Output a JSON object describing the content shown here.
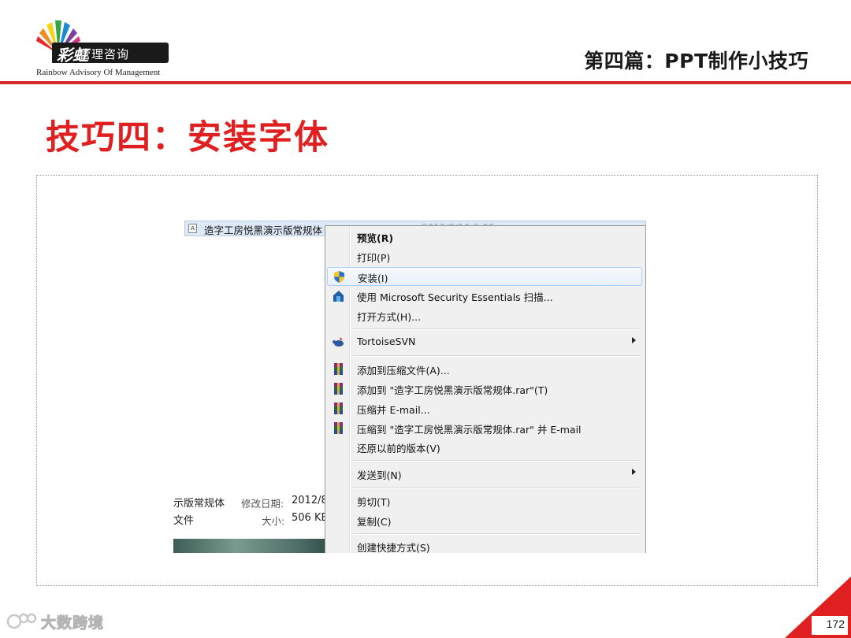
{
  "header": {
    "logo_mark": "彩虹",
    "logo_cn": "管理咨询",
    "logo_en": "Rainbow  Advisory  Of  Management",
    "section_title": "第四篇：PPT制作小技巧"
  },
  "slide": {
    "title": "技巧四：安装字体"
  },
  "explorer": {
    "file_name": "造字工房悦黑演示版常规体",
    "file_date": "2012/8/10 9:00",
    "details": {
      "name": "示版常规体",
      "modified_label": "修改日期:",
      "modified_value": "2012/8",
      "type": "文件",
      "size_label": "大小:",
      "size_value": "506 KB"
    }
  },
  "context_menu": {
    "items": [
      {
        "label": "预览(R)",
        "bold": true
      },
      {
        "label": "打印(P)"
      },
      {
        "label": "安装(I)",
        "icon": "shield-icon",
        "highlighted": true
      },
      {
        "label": "使用 Microsoft Security Essentials 扫描...",
        "icon": "security-essentials-icon"
      },
      {
        "label": "打开方式(H)..."
      },
      {
        "label": "TortoiseSVN",
        "icon": "tortoisesvn-icon",
        "submenu": true
      },
      {
        "label": "添加到压缩文件(A)...",
        "icon": "winrar-icon"
      },
      {
        "label": "添加到 \"造字工房悦黑演示版常规体.rar\"(T)",
        "icon": "winrar-icon"
      },
      {
        "label": "压缩并 E-mail...",
        "icon": "winrar-icon"
      },
      {
        "label": "压缩到 \"造字工房悦黑演示版常规体.rar\" 并 E-mail",
        "icon": "winrar-icon"
      },
      {
        "label": "还原以前的版本(V)"
      },
      {
        "label": "发送到(N)",
        "submenu": true
      },
      {
        "label": "剪切(T)"
      },
      {
        "label": "复制(C)"
      },
      {
        "label": "创建快捷方式(S)"
      }
    ]
  },
  "footer": {
    "page_number": "172",
    "watermark": "大数跨境",
    "accent_color": "#d42a2a"
  }
}
